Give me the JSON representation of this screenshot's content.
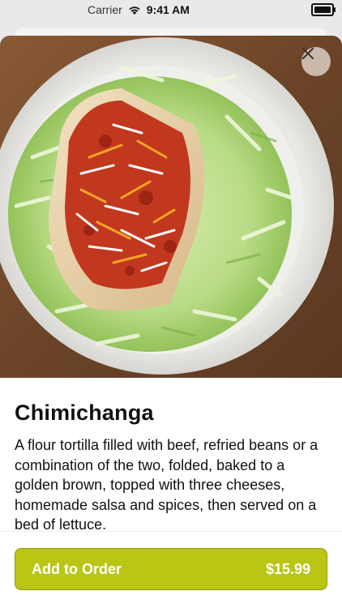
{
  "status_bar": {
    "carrier": "Carrier",
    "time": "9:41 AM"
  },
  "item": {
    "title": "Chimichanga",
    "description": "A flour tortilla filled with beef, refried beans or a combination of the two, folded, baked to a golden brown, topped with three cheeses, homemade salsa and spices, then served on a bed of lettuce.",
    "image_alt": "Chimichanga on a bed of shredded lettuce"
  },
  "order": {
    "label": "Add to Order",
    "price": "$15.99"
  },
  "colors": {
    "accent": "#b9c614",
    "text": "#111111"
  },
  "icons": {
    "close": "close-icon",
    "wifi": "wifi-icon",
    "battery": "battery-icon"
  }
}
